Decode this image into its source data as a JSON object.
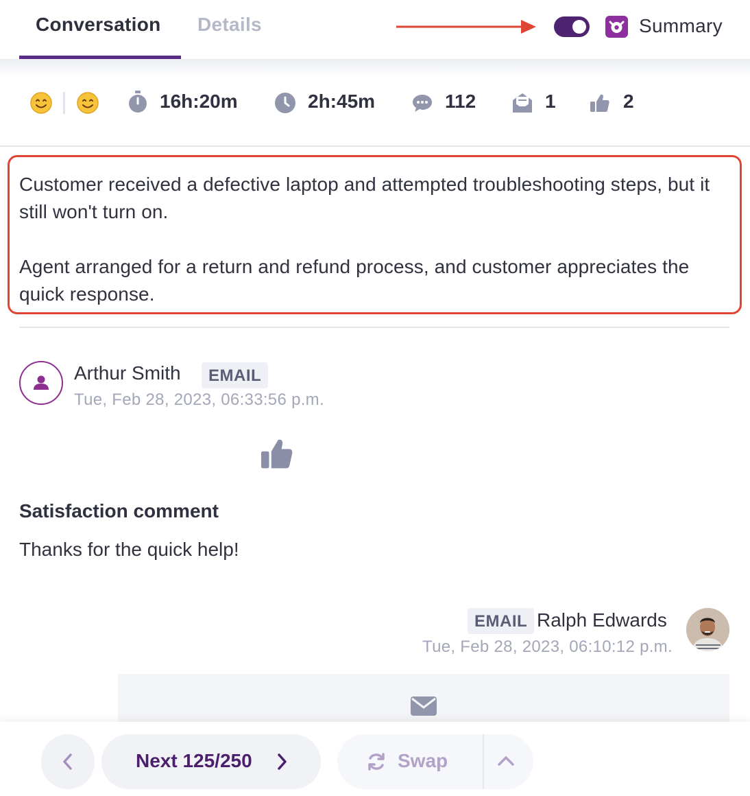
{
  "tabs": [
    {
      "label": "Conversation",
      "active": true
    },
    {
      "label": "Details",
      "active": false
    }
  ],
  "summary_toggle": {
    "label": "Summary",
    "on": true,
    "accent": "#4e2370",
    "icon": "ai-assistant-icon"
  },
  "stats": {
    "sentiment_start": "smile-emoji",
    "sentiment_end": "smile-emoji",
    "time_open": "16h:20m",
    "handle_time": "2h:45m",
    "messages": "112",
    "emails": "1",
    "likes": "2"
  },
  "summary": {
    "paragraph1": "Customer received a defective laptop and attempted troubleshooting steps, but it still won't turn on.",
    "paragraph2": "Agent arranged for a return and refund process, and customer appreciates the quick response.",
    "highlight_color": "#e04432"
  },
  "messages": [
    {
      "sender": "Arthur Smith",
      "channel": "EMAIL",
      "timestamp": "Tue, Feb 28, 2023, 06:33:56 p.m.",
      "reaction_icon": "thumbs-up-icon",
      "satisfaction_title": "Satisfaction comment",
      "satisfaction_text": "Thanks for the quick help!"
    },
    {
      "sender": "Ralph Edwards",
      "channel": "EMAIL",
      "timestamp": "Tue, Feb 28, 2023, 06:10:12 p.m.",
      "content_icon": "envelope-icon"
    }
  ],
  "footer": {
    "next_label": "Next 125/250",
    "swap_label": "Swap",
    "accent": "#4a1f6d"
  }
}
